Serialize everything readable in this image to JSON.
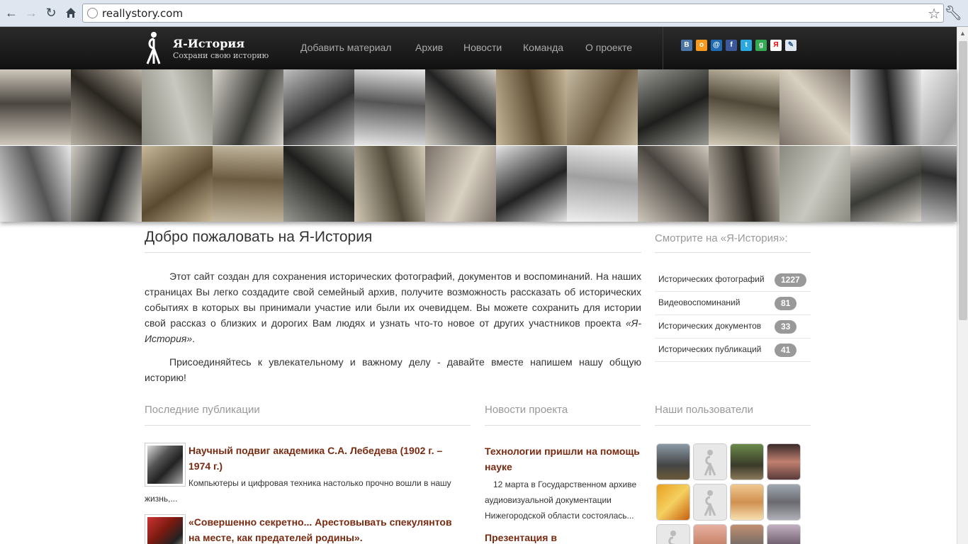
{
  "browser": {
    "url": "reallystory.com",
    "back_icon": "arrow-left-icon",
    "forward_icon": "arrow-right-icon",
    "reload_icon": "reload-icon",
    "home_icon": "home-icon",
    "bookmark_icon": "star-icon",
    "menu_icon": "wrench-icon"
  },
  "header": {
    "brand_title": "Я-История",
    "brand_tagline": "Сохрани свою историю",
    "nav": [
      "Добавить материал",
      "Архив",
      "Новости",
      "Команда",
      "О проекте"
    ],
    "share_icons": [
      "vkontakte-icon",
      "odnoklassniki-icon",
      "mailru-icon",
      "facebook-icon",
      "twitter-icon",
      "google-icon",
      "yandex-icon",
      "livejournal-icon"
    ]
  },
  "welcome": {
    "title": "Добро пожаловать на Я-История",
    "p1_text": "Этот сайт создан для сохранения исторических фотографий, документов и воспоминаний. На наших страницах Вы легко создадите свой семейный архив, получите возможность рассказать об исторических событиях в которых вы принимали участие или были их очевидцем. Вы можете сохранить для истории свой рассказ о близких и дорогих Вам людях и узнать что-то новое от других участников проекта ",
    "p1_em": "«Я-История»",
    "p1_end": ".",
    "p2": "Присоединяйтесь к увлекательному и важному делу - давайте вместе напишем нашу общую историю!"
  },
  "sidebar": {
    "title": "Смотрите на «Я-История»:",
    "stats": [
      {
        "label": "Исторических фотографий",
        "count": "1227"
      },
      {
        "label": "Видеовоспоминаний",
        "count": "81"
      },
      {
        "label": "Исторических документов",
        "count": "33"
      },
      {
        "label": "Исторических публикаций",
        "count": "41"
      }
    ]
  },
  "publications": {
    "title": "Последние публикации",
    "items": [
      {
        "title": "Научный подвиг академика С.А. Лебедева (1902 г. – 1974 г.)",
        "excerpt": "Компьютеры и цифровая техника настолько прочно вошли в нашу",
        "excerpt_cont": "жизнь,..."
      },
      {
        "title": "«Совершенно секретно... Арестовывать спекулянтов на месте, как предателей родины»."
      }
    ]
  },
  "news": {
    "title": "Новости проекта",
    "items": [
      {
        "title": "Технологии пришли на помощь науке",
        "text": "12 марта в Государственном архиве аудиовизуальной документации Нижегородской области состоялась..."
      },
      {
        "title": "Презентация в"
      }
    ]
  },
  "users": {
    "title": "Наши пользователи"
  }
}
